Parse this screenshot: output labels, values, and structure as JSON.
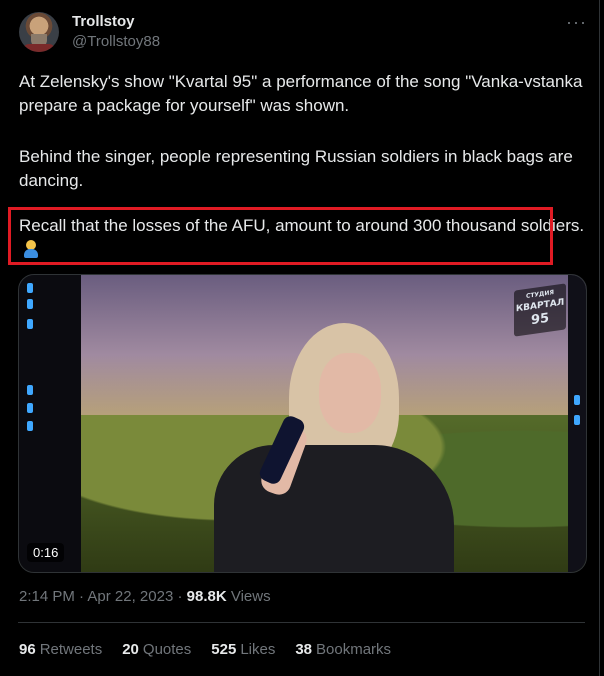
{
  "author": {
    "name": "Trollstoy",
    "handle": "@Trollstoy88"
  },
  "more_icon": "more-dots-icon",
  "tweet": {
    "paragraph1": "At Zelensky's show \"Kvartal 95\" a performance of the song \"Vanka-vstanka prepare a package for yourself\" was shown.",
    "paragraph2": "Behind the singer, people representing Russian soldiers in black bags are dancing.",
    "paragraph3": "Recall that the losses of the AFU, amount to around 300 thousand soldiers.",
    "paragraph3_emoji": "man-facepalming-emoji",
    "highlight_color": "#e01b24"
  },
  "video": {
    "duration": "0:16",
    "logo_top": "СТУДИЯ",
    "logo_main": "КВАРТАЛ",
    "logo_num": "95"
  },
  "meta": {
    "time": "2:14 PM",
    "date": "Apr 22, 2023",
    "dot": "·",
    "views_count": "98.8K",
    "views_label": "Views"
  },
  "stats": [
    {
      "count": "96",
      "label": "Retweets"
    },
    {
      "count": "20",
      "label": "Quotes"
    },
    {
      "count": "525",
      "label": "Likes"
    },
    {
      "count": "38",
      "label": "Bookmarks"
    }
  ],
  "colors": {
    "background": "#000000",
    "text": "#e7e9ea",
    "secondary_text": "#71767b",
    "border": "#2f3336"
  }
}
